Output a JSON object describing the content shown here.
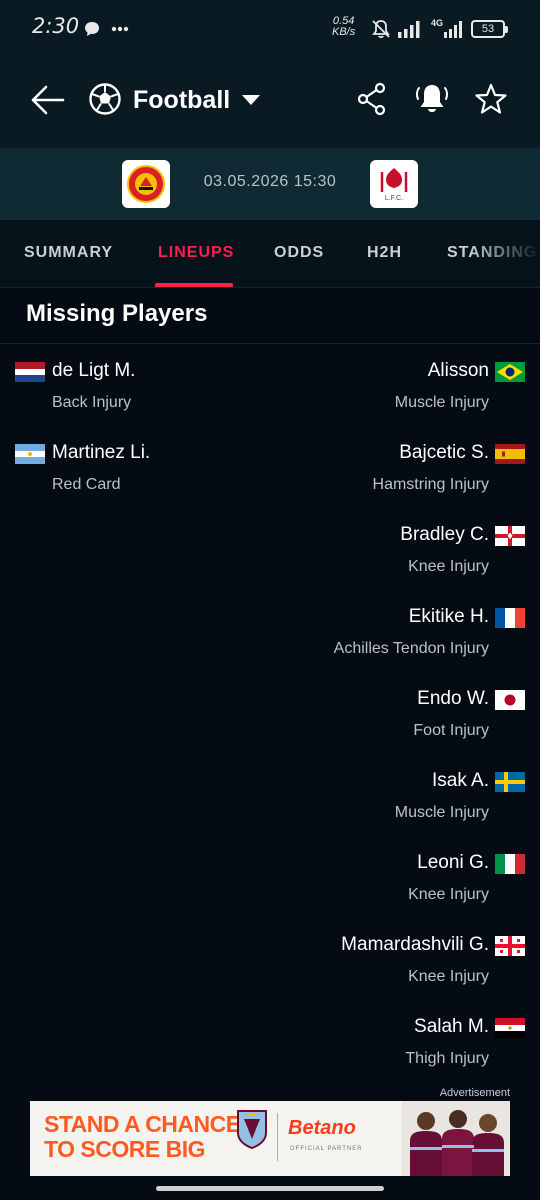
{
  "status_bar": {
    "time": "2:30",
    "speed_value": "0.54",
    "speed_unit": "KB/s",
    "network": "4G",
    "battery": "53",
    "icons": [
      "message-icon",
      "more-icon",
      "mute-icon",
      "signal-icon",
      "signal-4g-icon",
      "battery-icon"
    ]
  },
  "app_bar": {
    "sport": "Football",
    "icons": [
      "back-arrow-icon",
      "soccer-ball-icon",
      "dropdown-icon",
      "share-icon",
      "bell-icon",
      "star-icon"
    ]
  },
  "match": {
    "datetime": "03.05.2026 15:30",
    "home_logo": "manchester-united-crest",
    "away_logo": "liverpool-crest"
  },
  "tabs": [
    {
      "label": "SUMMARY",
      "active": false
    },
    {
      "label": "LINEUPS",
      "active": true
    },
    {
      "label": "ODDS",
      "active": false
    },
    {
      "label": "H2H",
      "active": false
    },
    {
      "label": "STANDINGS",
      "active": false
    }
  ],
  "missing": {
    "title": "Missing Players",
    "home": [
      {
        "name": "de Ligt M.",
        "reason": "Back Injury",
        "flag": "netherlands"
      },
      {
        "name": "Martinez Li.",
        "reason": "Red Card",
        "flag": "argentina"
      }
    ],
    "away": [
      {
        "name": "Alisson",
        "reason": "Muscle Injury",
        "flag": "brazil"
      },
      {
        "name": "Bajcetic S.",
        "reason": "Hamstring Injury",
        "flag": "spain"
      },
      {
        "name": "Bradley C.",
        "reason": "Knee Injury",
        "flag": "northern-ireland"
      },
      {
        "name": "Ekitike H.",
        "reason": "Achilles Tendon Injury",
        "flag": "france"
      },
      {
        "name": "Endo W.",
        "reason": "Foot Injury",
        "flag": "japan"
      },
      {
        "name": "Isak A.",
        "reason": "Muscle Injury",
        "flag": "sweden"
      },
      {
        "name": "Leoni G.",
        "reason": "Knee Injury",
        "flag": "italy"
      },
      {
        "name": "Mamardashvili G.",
        "reason": "Knee Injury",
        "flag": "georgia"
      },
      {
        "name": "Salah M.",
        "reason": "Thigh Injury",
        "flag": "egypt"
      }
    ]
  },
  "ad": {
    "label": "Advertisement",
    "headline_1": "STAND A CHANCE",
    "headline_2": "TO SCORE BIG",
    "brand": "Betano",
    "partner": "OFFICIAL PARTNER"
  },
  "colors": {
    "accent": "#ff1f4e",
    "background": "#050b12",
    "header": "#0a1a22",
    "match_header": "#0f2a33"
  }
}
